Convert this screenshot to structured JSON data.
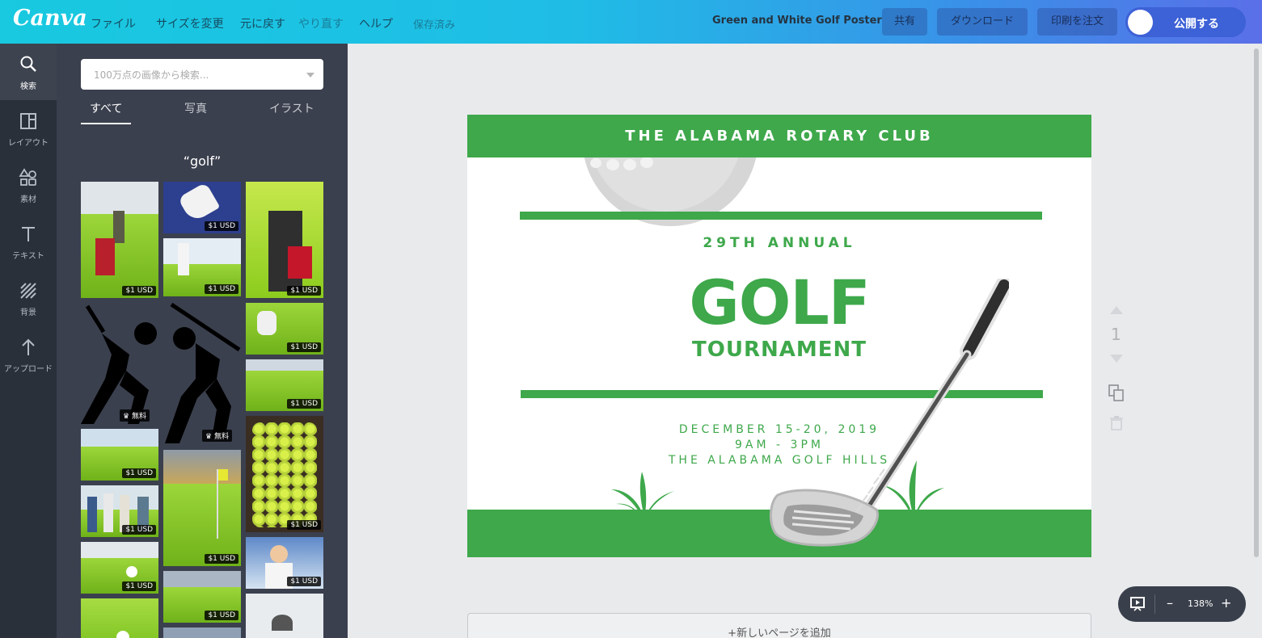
{
  "topbar": {
    "logo": "Canva",
    "menu": {
      "file": "ファイル",
      "resize": "サイズを変更",
      "undo": "元に戻す",
      "redo": "やり直す",
      "help": "ヘルプ",
      "saved": "保存済み"
    },
    "design_title": "Green and White Golf Poster",
    "share_label": "共有",
    "download_label": "ダウンロード",
    "print_label": "印刷を注文",
    "publish_label": "公開する"
  },
  "left_nav": {
    "items": [
      {
        "label": "検索",
        "icon": "search-icon"
      },
      {
        "label": "レイアウト",
        "icon": "layout-icon"
      },
      {
        "label": "素材",
        "icon": "elements-icon"
      },
      {
        "label": "テキスト",
        "icon": "text-icon"
      },
      {
        "label": "背景",
        "icon": "background-icon"
      },
      {
        "label": "アップロード",
        "icon": "upload-icon"
      }
    ]
  },
  "panel": {
    "search_placeholder": "100万点の画像から検索...",
    "tabs": {
      "all": "すべて",
      "photos": "写真",
      "illustrations": "イラスト"
    },
    "query": "“golf”",
    "price_label": "$1 USD",
    "free_label": "無料"
  },
  "poster": {
    "club": "THE ALABAMA ROTARY CLUB",
    "annual": "29TH ANNUAL",
    "headline": "GOLF",
    "subheadline": "TOURNAMENT",
    "date": "DECEMBER 15-20, 2019",
    "time": "9AM - 3PM",
    "venue": "THE ALABAMA GOLF HILLS",
    "colors": {
      "green": "#3ea84b",
      "background": "#ffffff"
    }
  },
  "page_controls": {
    "page_number": "1",
    "add_page_label": "+新しいページを追加"
  },
  "zoom": {
    "level": "138%",
    "minus": "–",
    "plus": "+"
  },
  "colors": {
    "topbar_start": "#18c9df",
    "topbar_end": "#5a6fe8",
    "sidebar": "#293039",
    "panel": "#3b404e",
    "accent": "#3d61d6"
  }
}
